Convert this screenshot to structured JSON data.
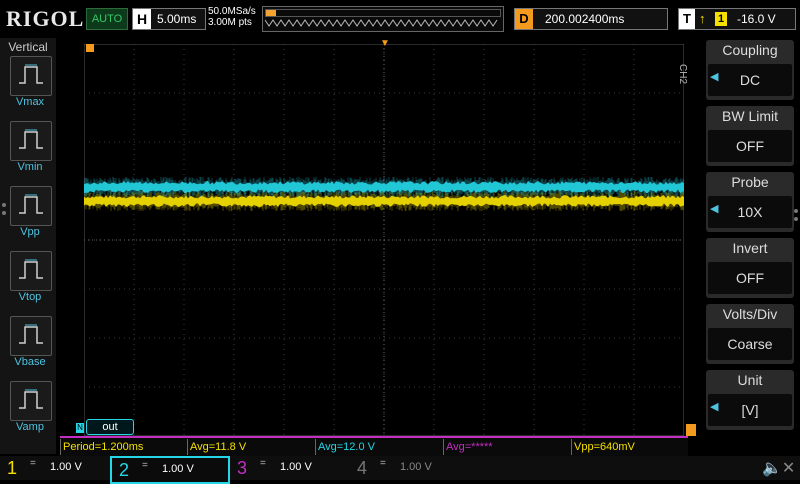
{
  "header": {
    "brand": "RIGOL",
    "run_state": "AUTO",
    "horizontal_key": "H",
    "timebase": "5.00ms",
    "sample_rate": "50.0MSa/s",
    "memory_depth": "3.00M pts",
    "delay_key": "D",
    "delay_value": "200.002400ms",
    "trigger_key": "T",
    "trigger_edge_icon": "rising-edge-icon",
    "trigger_source": "1",
    "trigger_level": "-16.0 V"
  },
  "left_panel": {
    "title": "Vertical",
    "items": [
      {
        "label": "Vmax",
        "icon": "vmax-icon"
      },
      {
        "label": "Vmin",
        "icon": "vmin-icon"
      },
      {
        "label": "Vpp",
        "icon": "vpp-icon"
      },
      {
        "label": "Vtop",
        "icon": "vtop-icon"
      },
      {
        "label": "Vbase",
        "icon": "vbase-icon"
      },
      {
        "label": "Vamp",
        "icon": "vamp-icon"
      }
    ]
  },
  "waveform": {
    "trace_label": "out",
    "ch1_color": "#f5e000",
    "ch2_color": "#25d6e6",
    "ch1_marker": "1",
    "ch2_marker": "2"
  },
  "right_panel": {
    "channel_tag": "CH2",
    "menu": [
      {
        "title": "Coupling",
        "value": "DC",
        "has_arrow": true
      },
      {
        "title": "BW Limit",
        "value": "OFF",
        "has_arrow": false
      },
      {
        "title": "Probe",
        "value": "10X",
        "has_arrow": true
      },
      {
        "title": "Invert",
        "value": "OFF",
        "has_arrow": false
      },
      {
        "title": "Volts/Div",
        "value": "Coarse",
        "has_arrow": false
      },
      {
        "title": "Unit",
        "value": "[V]",
        "has_arrow": true
      }
    ]
  },
  "measurements": [
    {
      "text": "Period=1.200ms",
      "color": "#f5e000"
    },
    {
      "text": "Avg=11.8 V",
      "color": "#f5e000"
    },
    {
      "text": "Avg=12.0 V",
      "color": "#25d6e6"
    },
    {
      "text": "Avg=*****",
      "color": "#c22fc2"
    },
    {
      "text": "Vpp=640mV",
      "color": "#f5e000"
    }
  ],
  "channels": [
    {
      "num": "1",
      "coupling": "=",
      "scale": "1.00 V",
      "color": "#f5e000"
    },
    {
      "num": "2",
      "coupling": "=",
      "scale": "1.00 V",
      "color": "#25d6e6"
    },
    {
      "num": "3",
      "coupling": "=",
      "scale": "1.00 V",
      "color": "#c22fc2"
    },
    {
      "num": "4",
      "coupling": "=",
      "scale": "1.00 V",
      "color": "#777777"
    }
  ],
  "speaker_icon": "speaker-muted-icon"
}
